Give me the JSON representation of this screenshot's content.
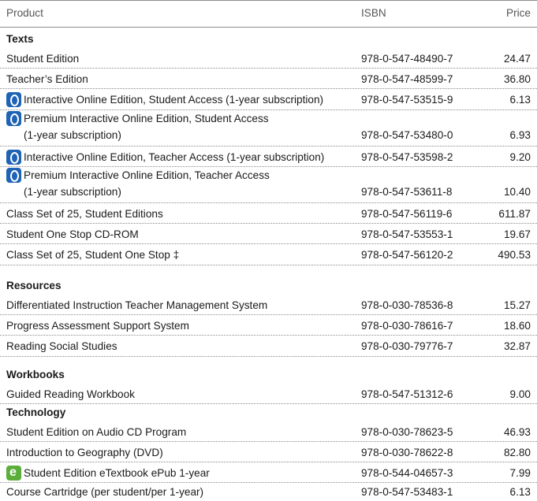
{
  "header": {
    "product": "Product",
    "isbn": "ISBN",
    "price": "Price"
  },
  "sections": {
    "texts": "Texts",
    "resources": "Resources",
    "workbooks": "Workbooks",
    "technology": "Technology"
  },
  "rows": [
    {
      "product": "Student Edition",
      "isbn": "978-0-547-48490-7",
      "price": "24.47",
      "icon": ""
    },
    {
      "product": "Teacher’s Edition",
      "isbn": "978-0-547-48599-7",
      "price": "36.80",
      "icon": ""
    },
    {
      "product": "Interactive Online Edition, Student Access (1-year subscription)",
      "isbn": "978-0-547-53515-9",
      "price": "6.13",
      "icon": "online-edition-icon"
    },
    {
      "product": "Premium Interactive Online Edition, Student Access",
      "product_line2": "(1-year subscription)",
      "isbn": "978-0-547-53480-0",
      "price": "6.93",
      "icon": "online-edition-icon"
    },
    {
      "product": "Interactive Online Edition, Teacher Access (1-year subscription)",
      "isbn": "978-0-547-53598-2",
      "price": "9.20",
      "icon": "online-edition-icon"
    },
    {
      "product": "Premium Interactive Online Edition, Teacher Access",
      "product_line2": "(1-year subscription)",
      "isbn": "978-0-547-53611-8",
      "price": "10.40",
      "icon": "online-edition-icon"
    },
    {
      "product": "Class Set of 25, Student Editions",
      "isbn": "978-0-547-56119-6",
      "price": "611.87",
      "icon": ""
    },
    {
      "product": "Student One Stop CD-ROM",
      "isbn": "978-0-547-53553-1",
      "price": "19.67",
      "icon": ""
    },
    {
      "product": "Class Set of 25, Student One Stop ‡",
      "isbn": "978-0-547-56120-2",
      "price": "490.53",
      "icon": ""
    },
    {
      "product": "Differentiated Instruction Teacher Management System",
      "isbn": "978-0-030-78536-8",
      "price": "15.27",
      "icon": ""
    },
    {
      "product": "Progress Assessment Support System",
      "isbn": "978-0-030-78616-7",
      "price": "18.60",
      "icon": ""
    },
    {
      "product": "Reading Social Studies",
      "isbn": "978-0-030-79776-7",
      "price": "32.87",
      "icon": ""
    },
    {
      "product": "Guided Reading Workbook",
      "isbn": "978-0-547-51312-6",
      "price": "9.00",
      "icon": ""
    },
    {
      "product": "Student Edition on Audio CD Program",
      "isbn": "978-0-030-78623-5",
      "price": "46.93",
      "icon": ""
    },
    {
      "product": "Introduction to Geography (DVD)",
      "isbn": "978-0-030-78622-8",
      "price": "82.80",
      "icon": ""
    },
    {
      "product": "Student Edition eTextbook ePub 1-year",
      "isbn": "978-0-544-04657-3",
      "price": "7.99",
      "icon": "etextbook-icon"
    },
    {
      "product": "Course Cartridge (per student/per 1-year)",
      "isbn": "978-0-547-53483-1",
      "price": "6.13",
      "icon": ""
    }
  ]
}
